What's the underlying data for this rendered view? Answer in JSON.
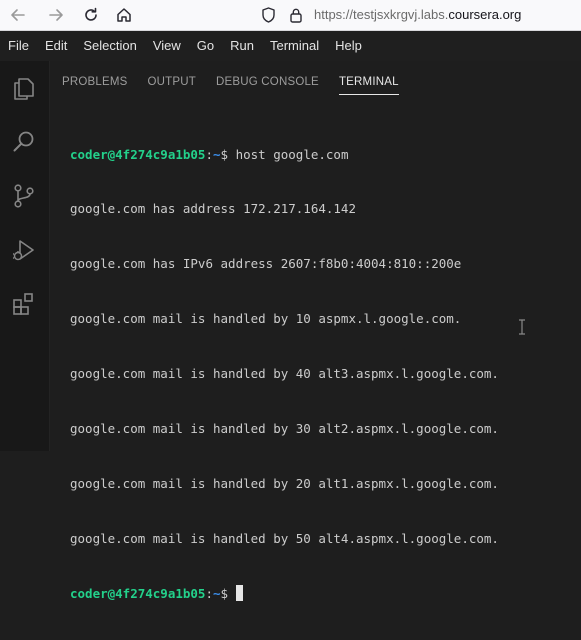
{
  "browser": {
    "url_prefix": "https://testjsxkrgvj.labs.",
    "url_domain": "coursera.org",
    "icons": [
      "back-arrow-icon",
      "forward-arrow-icon",
      "reload-icon",
      "home-icon",
      "shield-icon",
      "lock-icon"
    ]
  },
  "menu": [
    "File",
    "Edit",
    "Selection",
    "View",
    "Go",
    "Run",
    "Terminal",
    "Help"
  ],
  "activity_bar": [
    "explorer-icon",
    "search-icon",
    "source-control-icon",
    "run-debug-icon",
    "extensions-icon"
  ],
  "panel": {
    "tabs": [
      {
        "label": "PROBLEMS",
        "active": false
      },
      {
        "label": "OUTPUT",
        "active": false
      },
      {
        "label": "DEBUG CONSOLE",
        "active": false
      },
      {
        "label": "TERMINAL",
        "active": true
      }
    ]
  },
  "terminal": {
    "prompt_user": "coder@4f274c9a1b05",
    "prompt_sep": ":",
    "prompt_path": "~",
    "prompt_symbol": "$ ",
    "command": "host google.com",
    "output": [
      "google.com has address 172.217.164.142",
      "google.com has IPv6 address 2607:f8b0:4004:810::200e",
      "google.com mail is handled by 10 aspmx.l.google.com.",
      "google.com mail is handled by 40 alt3.aspmx.l.google.com.",
      "google.com mail is handled by 30 alt2.aspmx.l.google.com.",
      "google.com mail is handled by 20 alt1.aspmx.l.google.com.",
      "google.com mail is handled by 50 alt4.aspmx.l.google.com."
    ]
  },
  "colors": {
    "prompt_user": "#23d18b",
    "prompt_path": "#3b8eea",
    "background": "#1e1e1e"
  }
}
